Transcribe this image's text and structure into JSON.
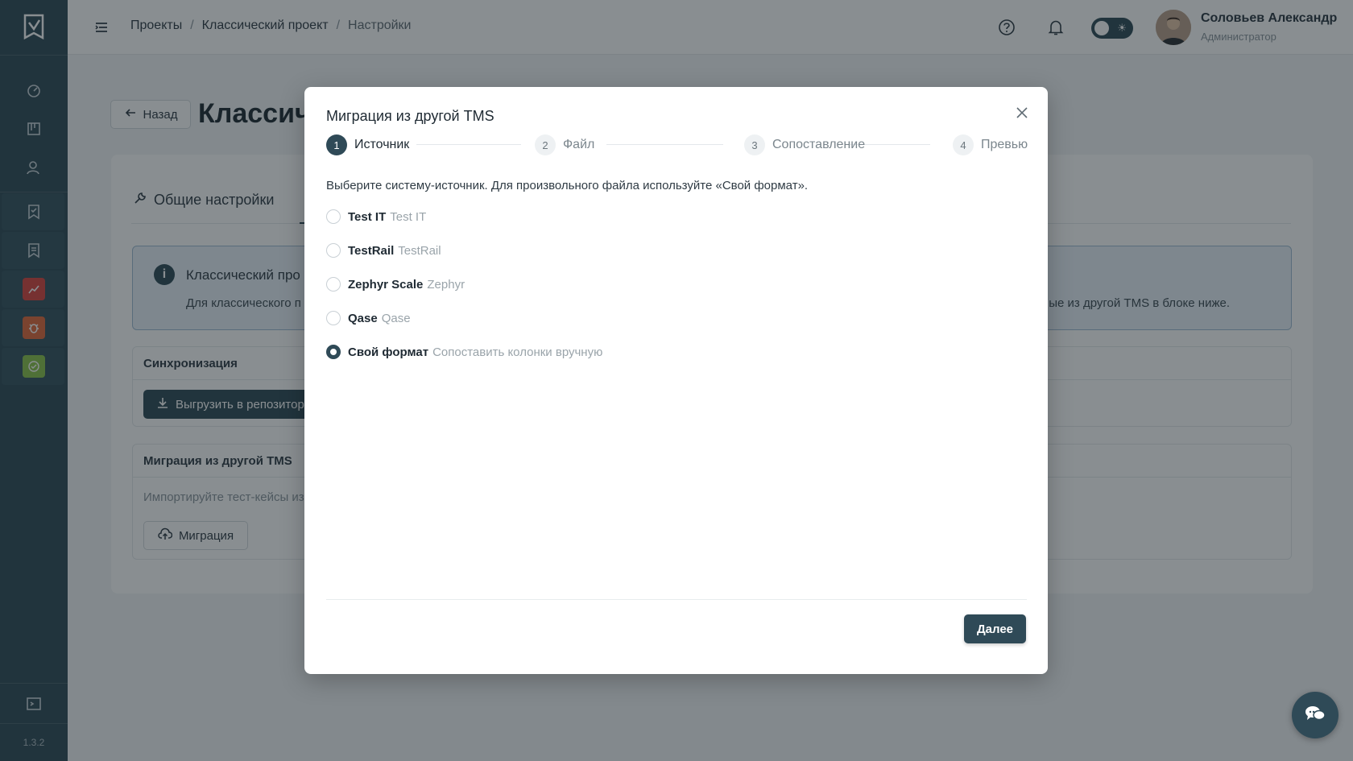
{
  "header": {
    "breadcrumb": [
      "Проекты",
      "Классический проект",
      "Настройки"
    ],
    "user_name": "Соловьев Александр",
    "user_role": "Администратор"
  },
  "sidebar": {
    "version": "1.3.2"
  },
  "page": {
    "back_label": "Назад",
    "title": "Классич",
    "tab_general": "Общие настройки",
    "info_title": "Классический про",
    "info_text_left": "Для классического п",
    "info_text_right": "ые из другой TMS в блоке ниже.",
    "sync_title": "Синхронизация",
    "sync_button": "Выгрузить в репозитор",
    "migration_title": "Миграция из другой TMS",
    "migration_desc": "Импортируйте тест-кейсы из",
    "migration_button": "Миграция"
  },
  "modal": {
    "title": "Миграция из другой TMS",
    "steps": [
      {
        "num": "1",
        "label": "Источник"
      },
      {
        "num": "2",
        "label": "Файл"
      },
      {
        "num": "3",
        "label": "Сопоставление"
      },
      {
        "num": "4",
        "label": "Превью"
      }
    ],
    "description": "Выберите систему-источник. Для произвольного файла используйте «Свой формат».",
    "options": [
      {
        "name": "Test IT",
        "hint": "Test IT",
        "checked": false
      },
      {
        "name": "TestRail",
        "hint": "TestRail",
        "checked": false
      },
      {
        "name": "Zephyr Scale",
        "hint": "Zephyr",
        "checked": false
      },
      {
        "name": "Qase",
        "hint": "Qase",
        "checked": false
      },
      {
        "name": "Свой формат",
        "hint": "Сопоставить колонки вручную",
        "checked": true
      }
    ],
    "next_label": "Далее"
  },
  "colors": {
    "primary": "#2f4a57",
    "sidebar": "#2f4a57",
    "danger": "#d9443f",
    "warning": "#e0683a",
    "success": "#8bc34a"
  }
}
